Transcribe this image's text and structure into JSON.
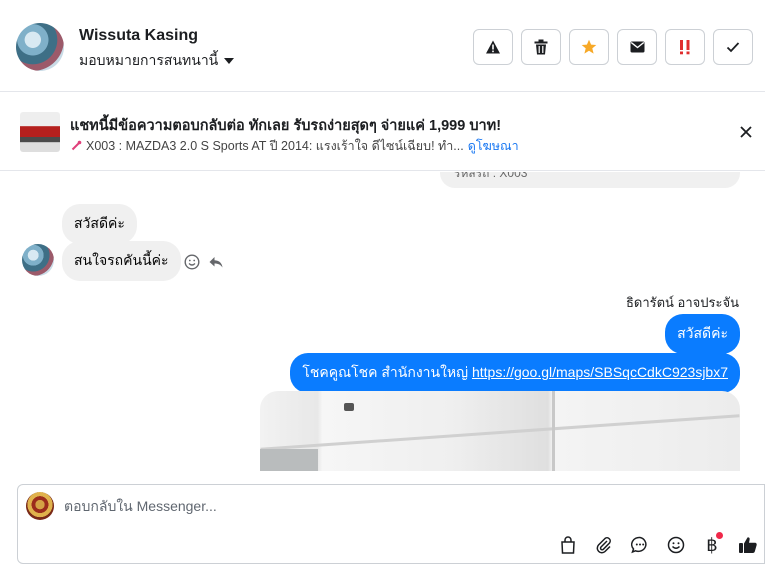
{
  "header": {
    "contact_name": "Wissuta Kasing",
    "assign_label": "มอบหมายการสนทนานี้",
    "actions": [
      {
        "name": "report-button",
        "icon": "warning-icon",
        "color": "#1c1e21"
      },
      {
        "name": "delete-button",
        "icon": "trash-icon",
        "color": "#1c1e21"
      },
      {
        "name": "star-button",
        "icon": "star-icon",
        "color": "#f7a928"
      },
      {
        "name": "mark-unread-button",
        "icon": "envelope-icon",
        "color": "#1c1e21"
      },
      {
        "name": "important-button",
        "icon": "double-exclamation-icon",
        "color": "#e02d2d"
      },
      {
        "name": "done-button",
        "icon": "check-icon",
        "color": "#1c1e21"
      }
    ]
  },
  "ad": {
    "title": "แชทนี้มีข้อความตอบกลับต่อ ทักเลย รับรถง่ายสุดๆ จ่ายแค่ 1,999 บาท!",
    "subtitle": "X003 : MAZDA3 2.0 S Sports AT ปี 2014: แรงเร้าใจ ดีไซน์เฉียบ! ทำ...",
    "link_label": "ดูโฆษณา"
  },
  "messages": {
    "previous_partial": "รหัสรถ : X003",
    "incoming": [
      {
        "text": "สวัสดีค่ะ"
      },
      {
        "text": "สนใจรถคันนี้ค่ะ"
      }
    ],
    "sender_name": "ธิดารัตน์ อาจประจัน",
    "outgoing": [
      {
        "text": "สวัสดีค่ะ"
      },
      {
        "prefix": "โชคคูณโชค สำนักงานใหญ่ ",
        "link": "https://goo.gl/maps/SBSqcCdkC923sjbx7"
      }
    ]
  },
  "reply": {
    "placeholder": "ตอบกลับใน Messenger..."
  },
  "colors": {
    "accent": "#0a7cff",
    "link": "#1877f2",
    "notification_dot": "#f02849"
  }
}
